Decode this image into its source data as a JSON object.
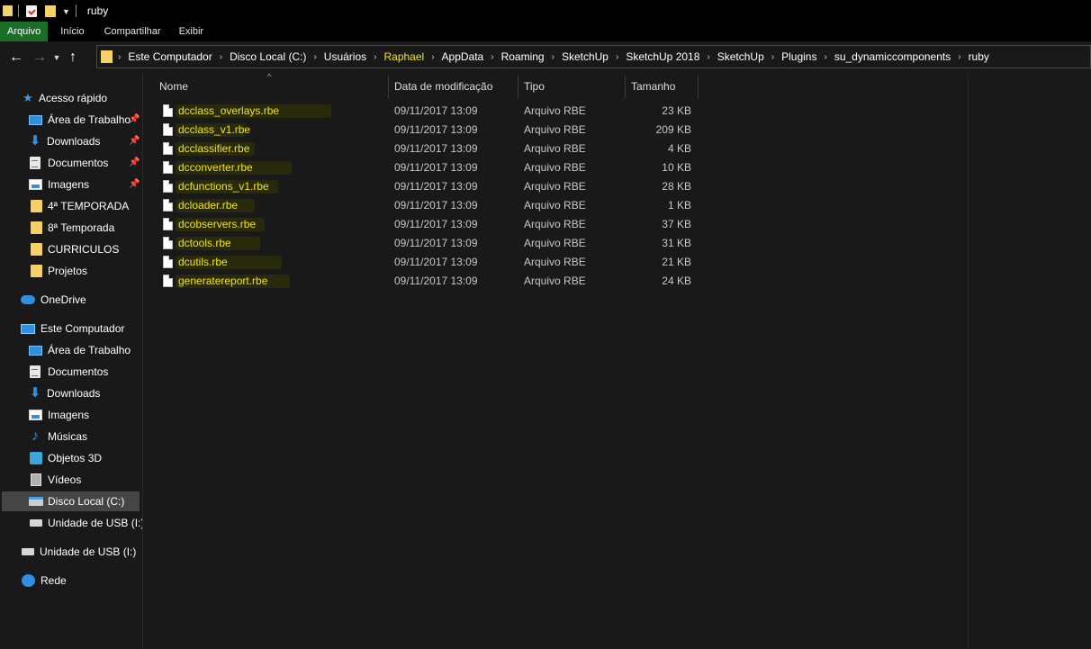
{
  "window": {
    "title": "ruby"
  },
  "ribbon": {
    "tabs": [
      "Arquivo",
      "Início",
      "Compartilhar",
      "Exibir"
    ]
  },
  "breadcrumb": [
    "Este Computador",
    "Disco Local (C:)",
    "Usuários",
    "Raphael",
    "AppData",
    "Roaming",
    "SketchUp",
    "SketchUp 2018",
    "SketchUp",
    "Plugins",
    "su_dynamiccomponents",
    "ruby"
  ],
  "columns": {
    "name": "Nome",
    "date": "Data de modificação",
    "type": "Tipo",
    "size": "Tamanho"
  },
  "sidebar": {
    "quick_access": "Acesso rápido",
    "quick_items": [
      "Área de Trabalho",
      "Downloads",
      "Documentos",
      "Imagens",
      "4ª TEMPORADA",
      "8ª Temporada",
      "CURRICULOS",
      "Projetos"
    ],
    "onedrive": "OneDrive",
    "this_pc": "Este Computador",
    "pc_items": [
      "Área de Trabalho",
      "Documentos",
      "Downloads",
      "Imagens",
      "Músicas",
      "Objetos 3D",
      "Vídeos",
      "Disco Local (C:)",
      "Unidade de USB (I:)"
    ],
    "usb": "Unidade de USB (I:)",
    "network": "Rede"
  },
  "files": [
    {
      "name": "dcclass_overlays.rbe",
      "date": "09/11/2017 13:09",
      "type": "Arquivo RBE",
      "size": "23 KB"
    },
    {
      "name": "dcclass_v1.rbe",
      "date": "09/11/2017 13:09",
      "type": "Arquivo RBE",
      "size": "209 KB"
    },
    {
      "name": "dcclassifier.rbe",
      "date": "09/11/2017 13:09",
      "type": "Arquivo RBE",
      "size": "4 KB"
    },
    {
      "name": "dcconverter.rbe",
      "date": "09/11/2017 13:09",
      "type": "Arquivo RBE",
      "size": "10 KB"
    },
    {
      "name": "dcfunctions_v1.rbe",
      "date": "09/11/2017 13:09",
      "type": "Arquivo RBE",
      "size": "28 KB"
    },
    {
      "name": "dcloader.rbe",
      "date": "09/11/2017 13:09",
      "type": "Arquivo RBE",
      "size": "1 KB"
    },
    {
      "name": "dcobservers.rbe",
      "date": "09/11/2017 13:09",
      "type": "Arquivo RBE",
      "size": "37 KB"
    },
    {
      "name": "dctools.rbe",
      "date": "09/11/2017 13:09",
      "type": "Arquivo RBE",
      "size": "31 KB"
    },
    {
      "name": "dcutils.rbe",
      "date": "09/11/2017 13:09",
      "type": "Arquivo RBE",
      "size": "21 KB"
    },
    {
      "name": "generatereport.rbe",
      "date": "09/11/2017 13:09",
      "type": "Arquivo RBE",
      "size": "24 KB"
    }
  ],
  "colors": {
    "highlight": "#f1e70f",
    "file_tab": "#1b6e28",
    "selected": "#454545"
  }
}
